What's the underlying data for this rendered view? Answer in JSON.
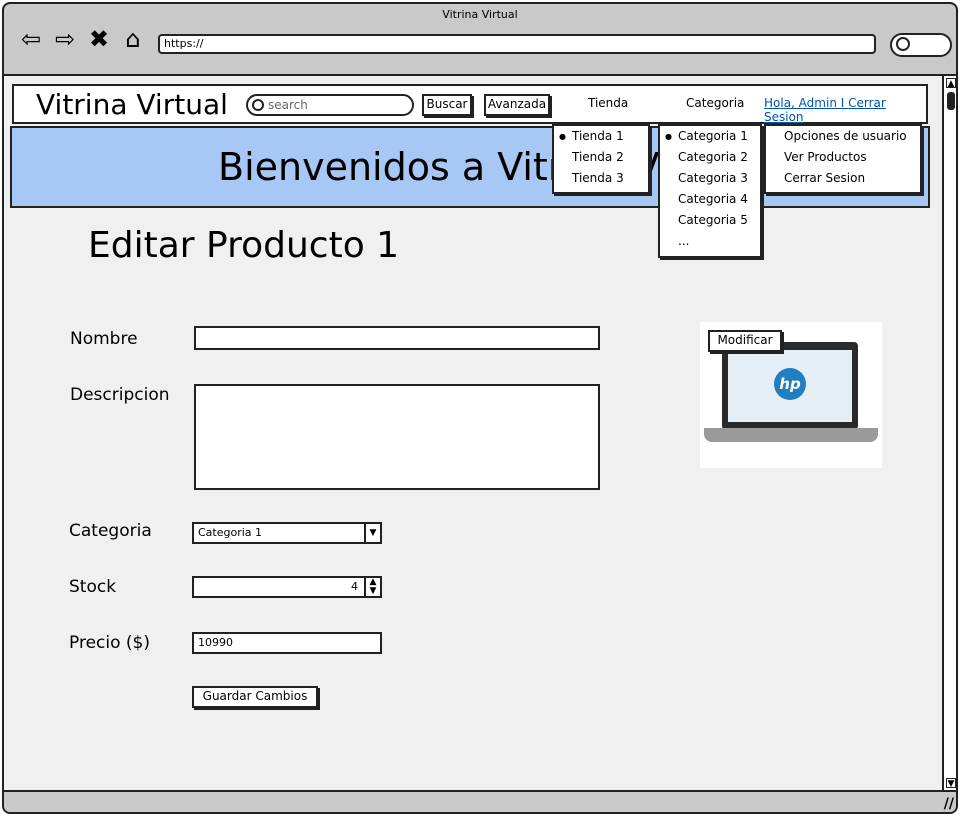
{
  "browser": {
    "title": "Vitrina Virtual",
    "url": "https://",
    "back_icon": "back-arrow-icon",
    "forward_icon": "forward-arrow-icon",
    "stop_icon": "close-icon",
    "home_icon": "home-icon"
  },
  "nav": {
    "site_title": "Vitrina Virtual",
    "search_placeholder": "search",
    "search_button": "Buscar",
    "advanced_button": "Avanzada",
    "tienda_label": "Tienda",
    "categoria_label": "Categoria",
    "user_link": "Hola, Admin I Cerrar Sesion"
  },
  "banner": {
    "text": "Bienvenidos a Vitrina Virtual"
  },
  "menus": {
    "tienda": [
      "Tienda 1",
      "Tienda 2",
      "Tienda 3"
    ],
    "categoria": [
      "Categoria 1",
      "Categoria 2",
      "Categoria 3",
      "Categoria 4",
      "Categoria 5",
      "..."
    ],
    "usuario": [
      "Opciones de usuario",
      "Ver Productos",
      "Cerrar Sesion"
    ]
  },
  "page": {
    "title": "Editar Producto 1"
  },
  "form": {
    "nombre_label": "Nombre",
    "nombre_value": "",
    "descripcion_label": "Descripcion",
    "descripcion_value": "",
    "categoria_label": "Categoria",
    "categoria_value": "Categoria 1",
    "stock_label": "Stock",
    "stock_value": "4",
    "precio_label": "Precio ($)",
    "precio_value": "10990",
    "save_button": "Guardar Cambios"
  },
  "image": {
    "modify_button": "Modificar",
    "logo_text": "hp"
  },
  "colors": {
    "banner": "#a7c8f5",
    "link": "#0055aa",
    "hp_logo": "#1f7fc1"
  }
}
